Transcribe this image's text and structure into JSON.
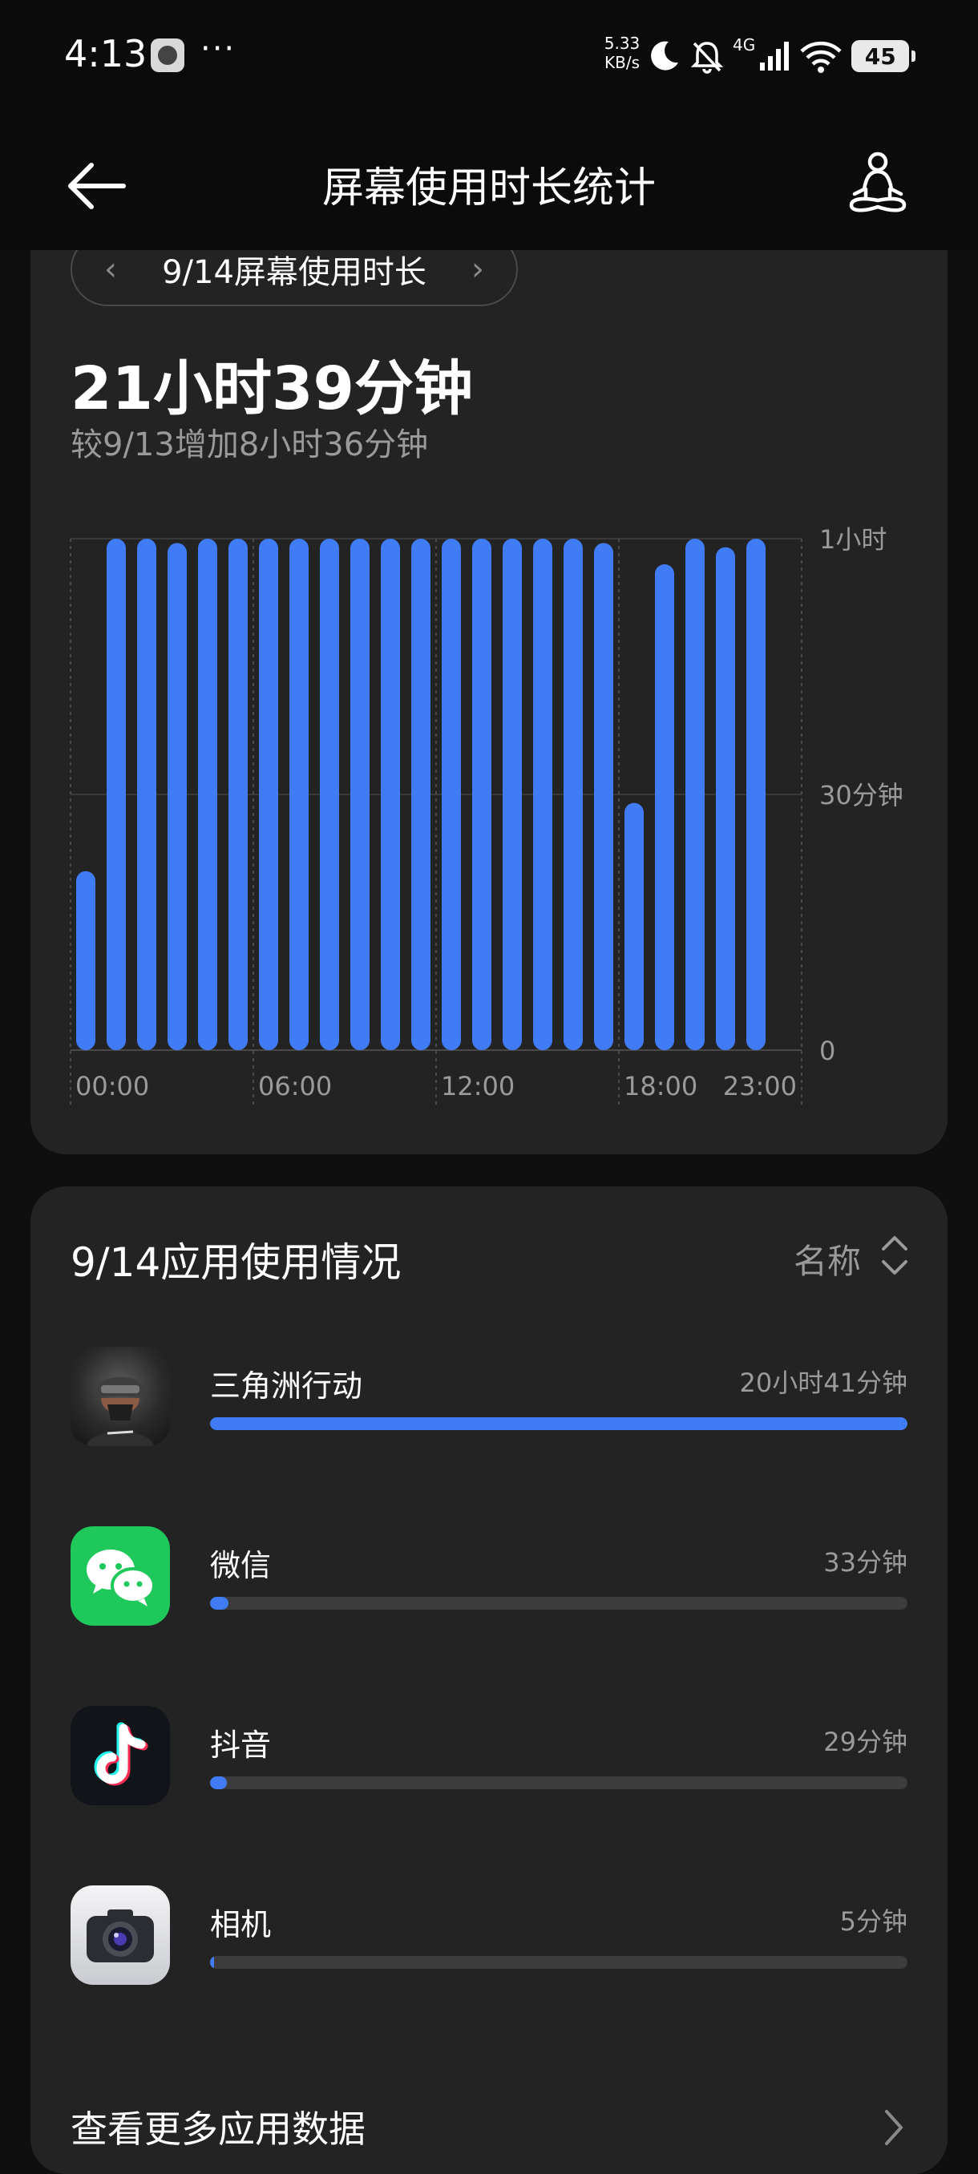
{
  "status_bar": {
    "time": "4:13",
    "more": "···",
    "net_speed_value": "5.33",
    "net_speed_unit": "KB/s",
    "network_type": "4G",
    "battery": "45",
    "icons": [
      "app-notification-icon",
      "moon-icon",
      "bell-off-icon",
      "signal-icon",
      "wifi-icon",
      "battery-icon"
    ]
  },
  "header": {
    "title": "屏幕使用时长统计"
  },
  "summary": {
    "date_label": "9/14屏幕使用时长",
    "total": "21小时39分钟",
    "compare": "较9/13增加8小时36分钟"
  },
  "chart_data": {
    "type": "bar",
    "categories": [
      "0",
      "1",
      "2",
      "3",
      "4",
      "5",
      "6",
      "7",
      "8",
      "9",
      "10",
      "11",
      "12",
      "13",
      "14",
      "15",
      "16",
      "17",
      "18",
      "19",
      "20",
      "21",
      "22",
      "23"
    ],
    "values": [
      21,
      60,
      60,
      59.5,
      60,
      60,
      60,
      60,
      60,
      60,
      60,
      60,
      60,
      60,
      60,
      60,
      60,
      59.5,
      29,
      57,
      60,
      59,
      60,
      0
    ],
    "x_tick_labels": [
      "00:00",
      "06:00",
      "12:00",
      "18:00",
      "23:00"
    ],
    "y_tick_labels": [
      "1小时",
      "30分钟",
      "0"
    ],
    "ylim": [
      0,
      60
    ],
    "color": "#3f7cf5",
    "grid": true
  },
  "apps": {
    "title": "9/14应用使用情况",
    "sort_label": "名称",
    "items": [
      {
        "name": "三角洲行动",
        "time": "20小时41分钟",
        "fraction": 1.0
      },
      {
        "name": "微信",
        "time": "33分钟",
        "fraction": 0.027
      },
      {
        "name": "抖音",
        "time": "29分钟",
        "fraction": 0.024
      },
      {
        "name": "相机",
        "time": "5分钟",
        "fraction": 0.004
      }
    ],
    "more_label": "查看更多应用数据"
  },
  "colors": {
    "accent": "#3f7cf5",
    "card": "#232323",
    "background": "#0f0f0f"
  }
}
